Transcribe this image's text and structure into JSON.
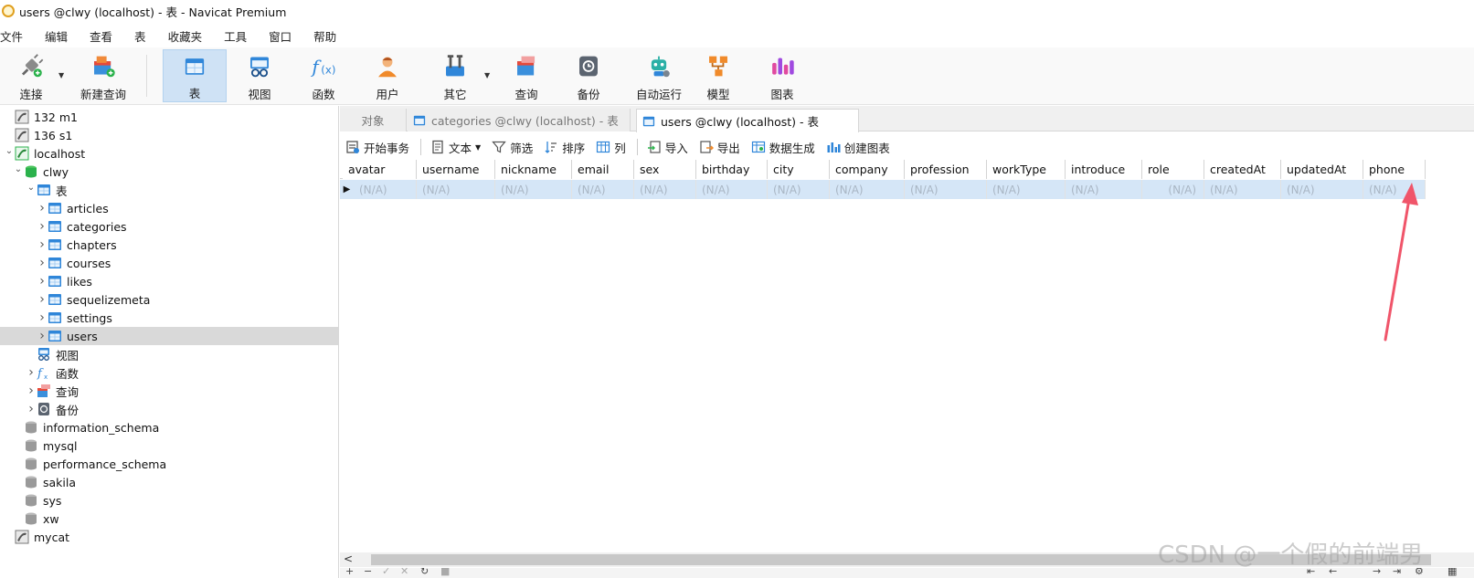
{
  "window": {
    "title": "users @clwy (localhost) - 表 - Navicat Premium"
  },
  "menu": [
    "文件",
    "编辑",
    "查看",
    "表",
    "收藏夹",
    "工具",
    "窗口",
    "帮助"
  ],
  "toolbar": {
    "items": [
      {
        "label": "连接",
        "icon": "connect-icon"
      },
      {
        "label": "新建查询",
        "icon": "new-query-icon"
      },
      {
        "label": "表",
        "icon": "table-icon",
        "active": true
      },
      {
        "label": "视图",
        "icon": "view-icon"
      },
      {
        "label": "函数",
        "icon": "function-icon"
      },
      {
        "label": "用户",
        "icon": "user-icon"
      },
      {
        "label": "其它",
        "icon": "tools-icon"
      },
      {
        "label": "查询",
        "icon": "query-icon"
      },
      {
        "label": "备份",
        "icon": "backup-icon"
      },
      {
        "label": "自动运行",
        "icon": "robot-icon"
      },
      {
        "label": "模型",
        "icon": "model-icon"
      },
      {
        "label": "图表",
        "icon": "chart-icon"
      }
    ]
  },
  "tree": [
    {
      "label": "132 m1",
      "level": 0,
      "icon": "mysql-connection-icon",
      "arrow": ""
    },
    {
      "label": "136 s1",
      "level": 0,
      "icon": "mysql-connection-icon",
      "arrow": ""
    },
    {
      "label": "localhost",
      "level": 0,
      "icon": "mysql-connection-active-icon",
      "arrow": "v"
    },
    {
      "label": "clwy",
      "level": 1,
      "icon": "database-active-icon",
      "arrow": "v"
    },
    {
      "label": "表",
      "level": 2,
      "icon": "table-folder-icon",
      "arrow": "v"
    },
    {
      "label": "articles",
      "level": 3,
      "icon": "table-icon",
      "arrow": ">"
    },
    {
      "label": "categories",
      "level": 3,
      "icon": "table-icon",
      "arrow": ">"
    },
    {
      "label": "chapters",
      "level": 3,
      "icon": "table-icon",
      "arrow": ">"
    },
    {
      "label": "courses",
      "level": 3,
      "icon": "table-icon",
      "arrow": ">"
    },
    {
      "label": "likes",
      "level": 3,
      "icon": "table-icon",
      "arrow": ">"
    },
    {
      "label": "sequelizemeta",
      "level": 3,
      "icon": "table-icon",
      "arrow": ">"
    },
    {
      "label": "settings",
      "level": 3,
      "icon": "table-icon",
      "arrow": ">"
    },
    {
      "label": "users",
      "level": 3,
      "icon": "table-icon",
      "arrow": ">",
      "selected": true
    },
    {
      "label": "视图",
      "level": 2,
      "icon": "view-icon",
      "arrow": ""
    },
    {
      "label": "函数",
      "level": 2,
      "icon": "function-icon",
      "arrow": ">"
    },
    {
      "label": "查询",
      "level": 2,
      "icon": "query-icon",
      "arrow": ">"
    },
    {
      "label": "备份",
      "level": 2,
      "icon": "backup-icon",
      "arrow": ">"
    },
    {
      "label": "information_schema",
      "level": 1,
      "icon": "database-icon",
      "arrow": ""
    },
    {
      "label": "mysql",
      "level": 1,
      "icon": "database-icon",
      "arrow": ""
    },
    {
      "label": "performance_schema",
      "level": 1,
      "icon": "database-icon",
      "arrow": ""
    },
    {
      "label": "sakila",
      "level": 1,
      "icon": "database-icon",
      "arrow": ""
    },
    {
      "label": "sys",
      "level": 1,
      "icon": "database-icon",
      "arrow": ""
    },
    {
      "label": "xw",
      "level": 1,
      "icon": "database-icon",
      "arrow": ""
    },
    {
      "label": "mycat",
      "level": 0,
      "icon": "mysql-connection-icon",
      "arrow": ""
    }
  ],
  "tabs": {
    "objects": "对象",
    "categories": "categories @clwy (localhost) - 表",
    "users": "users @clwy (localhost) - 表"
  },
  "table_toolbar": {
    "begin_transaction": "开始事务",
    "text": "文本",
    "filter": "筛选",
    "sort": "排序",
    "columns": "列",
    "import": "导入",
    "export": "导出",
    "data_generation": "数据生成",
    "create_chart": "创建图表"
  },
  "grid": {
    "columns": [
      "avatar",
      "username",
      "nickname",
      "email",
      "sex",
      "birthday",
      "city",
      "company",
      "profession",
      "workType",
      "introduce",
      "role",
      "createdAt",
      "updatedAt",
      "phone"
    ],
    "null_value": "(N/A)"
  },
  "watermark": "CSDN @一个假的前端男",
  "colors": {
    "accent": "#cfe2f5",
    "selected_row": "#d5e6f7",
    "annotation_arrow": "#f0556a"
  }
}
